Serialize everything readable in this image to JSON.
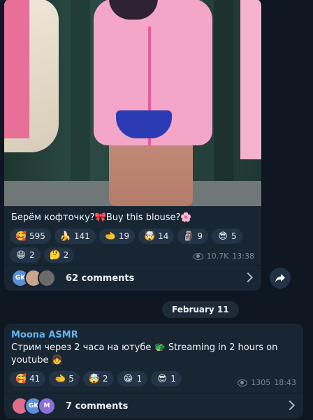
{
  "post1": {
    "caption": "Берём кофточку?🎀Buy this blouse?🌸",
    "reactions": [
      {
        "icon": "🥰",
        "count": "595"
      },
      {
        "icon": "🍌",
        "count": "141"
      },
      {
        "icon": "🫲",
        "count": "19"
      },
      {
        "icon": "🤯",
        "count": "14"
      },
      {
        "icon": "🗿",
        "count": "9"
      },
      {
        "icon": "😎",
        "count": "5"
      },
      {
        "icon": "😁",
        "count": "2"
      },
      {
        "icon": "🤔",
        "count": "2"
      }
    ],
    "views": "10.7K",
    "time": "13:38",
    "comment_avatars": [
      {
        "label": "GK",
        "color": "#5b8fd6"
      },
      {
        "label": "",
        "color": "#c9a58b"
      },
      {
        "label": "",
        "color": "#6b6b6b"
      }
    ],
    "comments_label": "62 comments",
    "share_icon": "share-arrow-icon"
  },
  "date_separator": "February 11",
  "post2": {
    "author": "Moona ASMR",
    "text": "Стрим через 2 часа на ютубе 🐲 Streaming in 2 hours on youtube 👧",
    "reactions": [
      {
        "icon": "🥰",
        "count": "41"
      },
      {
        "icon": "🫲",
        "count": "5"
      },
      {
        "icon": "🤯",
        "count": "2"
      },
      {
        "icon": "😁",
        "count": "1"
      },
      {
        "icon": "😎",
        "count": "1"
      }
    ],
    "views": "1305",
    "time": "18:43",
    "comment_avatars": [
      {
        "label": "",
        "color": "#e06c8a"
      },
      {
        "label": "GK",
        "color": "#5b8fd6"
      },
      {
        "label": "M",
        "color": "#8e6fd8"
      }
    ],
    "comments_label": "7 comments"
  }
}
